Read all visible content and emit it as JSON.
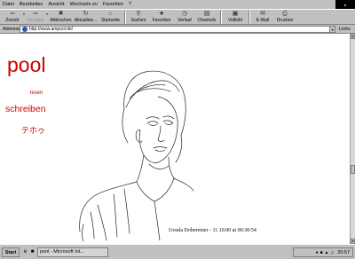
{
  "menu": {
    "items": [
      "Datei",
      "Bearbeiten",
      "Ansicht",
      "Wechseln zu",
      "Favoriten",
      "?"
    ]
  },
  "toolbar": {
    "buttons": [
      {
        "label": "Zurück",
        "icon": "back-arrow-icon",
        "enabled": true
      },
      {
        "label": "Vorwärts",
        "icon": "forward-arrow-icon",
        "enabled": false
      },
      {
        "label": "Abbrechen",
        "icon": "stop-icon",
        "enabled": true
      },
      {
        "label": "Aktualisie...",
        "icon": "refresh-icon",
        "enabled": true
      },
      {
        "label": "Startseite",
        "icon": "home-icon",
        "enabled": true
      },
      {
        "label": "Suchen",
        "icon": "search-icon",
        "enabled": true
      },
      {
        "label": "Favoriten",
        "icon": "favorites-icon",
        "enabled": true
      },
      {
        "label": "Verlauf",
        "icon": "history-icon",
        "enabled": true
      },
      {
        "label": "Channels",
        "icon": "channels-icon",
        "enabled": true
      },
      {
        "label": "Vollbild",
        "icon": "fullscreen-icon",
        "enabled": true
      },
      {
        "label": "E-Mail",
        "icon": "mail-icon",
        "enabled": true
      },
      {
        "label": "Drucken",
        "icon": "print-icon",
        "enabled": true
      }
    ]
  },
  "address": {
    "label": "Adresse",
    "url": "http://www.ampool.de/",
    "links_label": "Links"
  },
  "page": {
    "logo": "pool",
    "nav_lesen": "lesen",
    "nav_schreiben": "schreiben",
    "nav_kana": "テホゥ",
    "caption": "Ursula Dobereiner - 11.10.00 at 00:30:54"
  },
  "taskbar": {
    "start_label": "Start",
    "task_label": "pool - Microsoft Int...",
    "clock": "20:57"
  },
  "colors": {
    "accent_red": "#cc0000",
    "chrome_gray": "#c0c0c0"
  }
}
